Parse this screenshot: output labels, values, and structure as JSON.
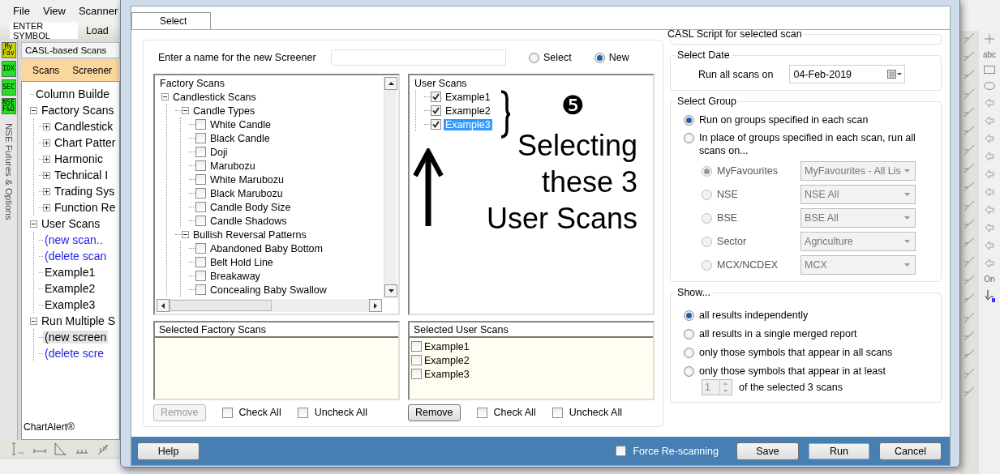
{
  "app": {
    "menu": [
      {
        "label": "File"
      },
      {
        "label": "View"
      },
      {
        "label": "Scanner"
      }
    ],
    "symbol_field": {
      "value": "ENTER SYMBOL"
    },
    "toolbar_buttons": [
      "Load"
    ],
    "side_tabs": [
      {
        "label": "My Fav",
        "color": "#c8d400"
      },
      {
        "label": "IDX",
        "color": "#22e022"
      },
      {
        "label": "SEC",
        "color": "#22e022"
      },
      {
        "label": "NSE F&O",
        "color": "#22e022"
      }
    ],
    "vertical_tab": "NSE Futures & Options",
    "panel_title": "CASL-based Scans",
    "panel_tabs": [
      "Scans",
      "Screener"
    ],
    "tree": [
      {
        "label": "Column Builde",
        "selected": false
      },
      {
        "label": "Factory Scans",
        "expanded": true,
        "selected": false,
        "children": [
          {
            "label": "Candlestick",
            "expanded": false,
            "selected": false
          },
          {
            "label": "Chart Patter",
            "expanded": false,
            "selected": false
          },
          {
            "label": "Harmonic",
            "expanded": false,
            "selected": false
          },
          {
            "label": "Technical I",
            "expanded": false,
            "selected": false
          },
          {
            "label": "Trading Sys",
            "expanded": false,
            "selected": false
          },
          {
            "label": "Function Re",
            "expanded": false,
            "selected": false
          }
        ]
      },
      {
        "label": "User Scans",
        "expanded": true,
        "selected": false,
        "children": [
          {
            "label": "(new scan..",
            "kind": "link",
            "selected": false
          },
          {
            "label": "(delete scan",
            "kind": "link",
            "selected": false
          },
          {
            "label": "Example1",
            "selected": false
          },
          {
            "label": "Example2",
            "selected": false
          },
          {
            "label": "Example3",
            "selected": false
          }
        ]
      },
      {
        "label": "Run Multiple S",
        "expanded": true,
        "selected": false,
        "children": [
          {
            "label": "(new screen",
            "selected": true
          },
          {
            "label": "(delete scre",
            "kind": "link",
            "selected": false
          }
        ]
      }
    ],
    "footer": "ChartAlert®",
    "tool_labels": [
      "abc",
      "On"
    ]
  },
  "dialog": {
    "tabs": [
      {
        "label": "Select",
        "selected": true
      }
    ],
    "name_label": "Enter a name for the new Screener",
    "mode_options": [
      {
        "label": "Select",
        "selected": false
      },
      {
        "label": "New",
        "selected": true
      }
    ],
    "factory_tree": {
      "title": "Factory Scans",
      "nodes": [
        {
          "label": "Candlestick Scans",
          "expanded": true,
          "children": [
            {
              "label": "Candle Types",
              "expanded": true,
              "children": [
                {
                  "label": "White Candle",
                  "checked": false,
                  "selected": false
                },
                {
                  "label": "Black Candle",
                  "checked": false,
                  "selected": false
                },
                {
                  "label": "Doji",
                  "checked": false,
                  "selected": false
                },
                {
                  "label": "Marubozu",
                  "checked": false,
                  "selected": false
                },
                {
                  "label": "White Marubozu",
                  "checked": false,
                  "selected": false
                },
                {
                  "label": "Black Marubozu",
                  "checked": false,
                  "selected": false
                },
                {
                  "label": "Candle Body Size",
                  "checked": false,
                  "selected": false
                },
                {
                  "label": "Candle Shadows",
                  "checked": false,
                  "selected": false
                }
              ]
            },
            {
              "label": "Bullish Reversal Patterns",
              "expanded": true,
              "children": [
                {
                  "label": "Abandoned Baby Bottom",
                  "checked": false,
                  "selected": false
                },
                {
                  "label": "Belt Hold Line",
                  "checked": false,
                  "selected": false
                },
                {
                  "label": "Breakaway",
                  "checked": false,
                  "selected": false
                },
                {
                  "label": "Concealing Baby Swallow",
                  "checked": false,
                  "selected": false
                }
              ]
            }
          ]
        }
      ]
    },
    "user_tree": {
      "title": "User Scans",
      "nodes": [
        {
          "label": "Example1",
          "checked": true,
          "selected": false
        },
        {
          "label": "Example2",
          "checked": true,
          "selected": false
        },
        {
          "label": "Example3",
          "checked": true,
          "selected": true
        }
      ]
    },
    "annotation": {
      "badge": "❺",
      "lines": [
        "Selecting",
        "these 3",
        "User Scans"
      ]
    },
    "selected_factory": {
      "title": "Selected Factory Scans",
      "remove": {
        "label": "Remove",
        "disabled": true
      },
      "check_all": {
        "label": "Check All",
        "checked": false
      },
      "uncheck_all": {
        "label": "Uncheck All",
        "checked": false
      }
    },
    "selected_user": {
      "title": "Selected User Scans",
      "items": [
        {
          "label": "Example1",
          "checked": false
        },
        {
          "label": "Example2",
          "checked": false
        },
        {
          "label": "Example3",
          "checked": false
        }
      ],
      "remove": {
        "label": "Remove",
        "disabled": false
      },
      "check_all": {
        "label": "Check All",
        "checked": false
      },
      "uncheck_all": {
        "label": "Uncheck All",
        "checked": false
      }
    },
    "casl_group": {
      "title": "CASL Script for selected scan"
    },
    "date_group": {
      "title": "Select Date",
      "label": "Run all scans on",
      "value": "04-Feb-2019"
    },
    "group_group": {
      "title": "Select Group",
      "options": [
        {
          "label": "Run on groups specified in each scan",
          "selected": true
        },
        {
          "label": "In place of groups specified in each scan, run all scans on...",
          "selected": false
        }
      ],
      "sources": [
        {
          "label": "MyFavourites",
          "selected": true,
          "disabled": true,
          "value": "MyFavourites - All Lis"
        },
        {
          "label": "NSE",
          "selected": false,
          "disabled": true,
          "value": "NSE All"
        },
        {
          "label": "BSE",
          "selected": false,
          "disabled": true,
          "value": "BSE All"
        },
        {
          "label": "Sector",
          "selected": false,
          "disabled": true,
          "value": "Agriculture"
        },
        {
          "label": "MCX/NCDEX",
          "selected": false,
          "disabled": true,
          "value": "MCX"
        }
      ]
    },
    "show_group": {
      "title": "Show...",
      "options": [
        {
          "label": "all results independently",
          "selected": true
        },
        {
          "label": "all results in a single merged report",
          "selected": false
        },
        {
          "label": "only those symbols that appear in all scans",
          "selected": false
        },
        {
          "label": "only those symbols that appear in at least",
          "selected": false
        }
      ],
      "spinner": {
        "value": "1",
        "disabled": true
      },
      "suffix": "of the selected 3 scans"
    },
    "footer": {
      "help": "Help",
      "force_rescan": {
        "label": "Force Re-scanning",
        "checked": false
      },
      "buttons": [
        {
          "label": "Save",
          "default": false
        },
        {
          "label": "Run",
          "default": true
        },
        {
          "label": "Cancel",
          "default": false
        }
      ]
    }
  }
}
